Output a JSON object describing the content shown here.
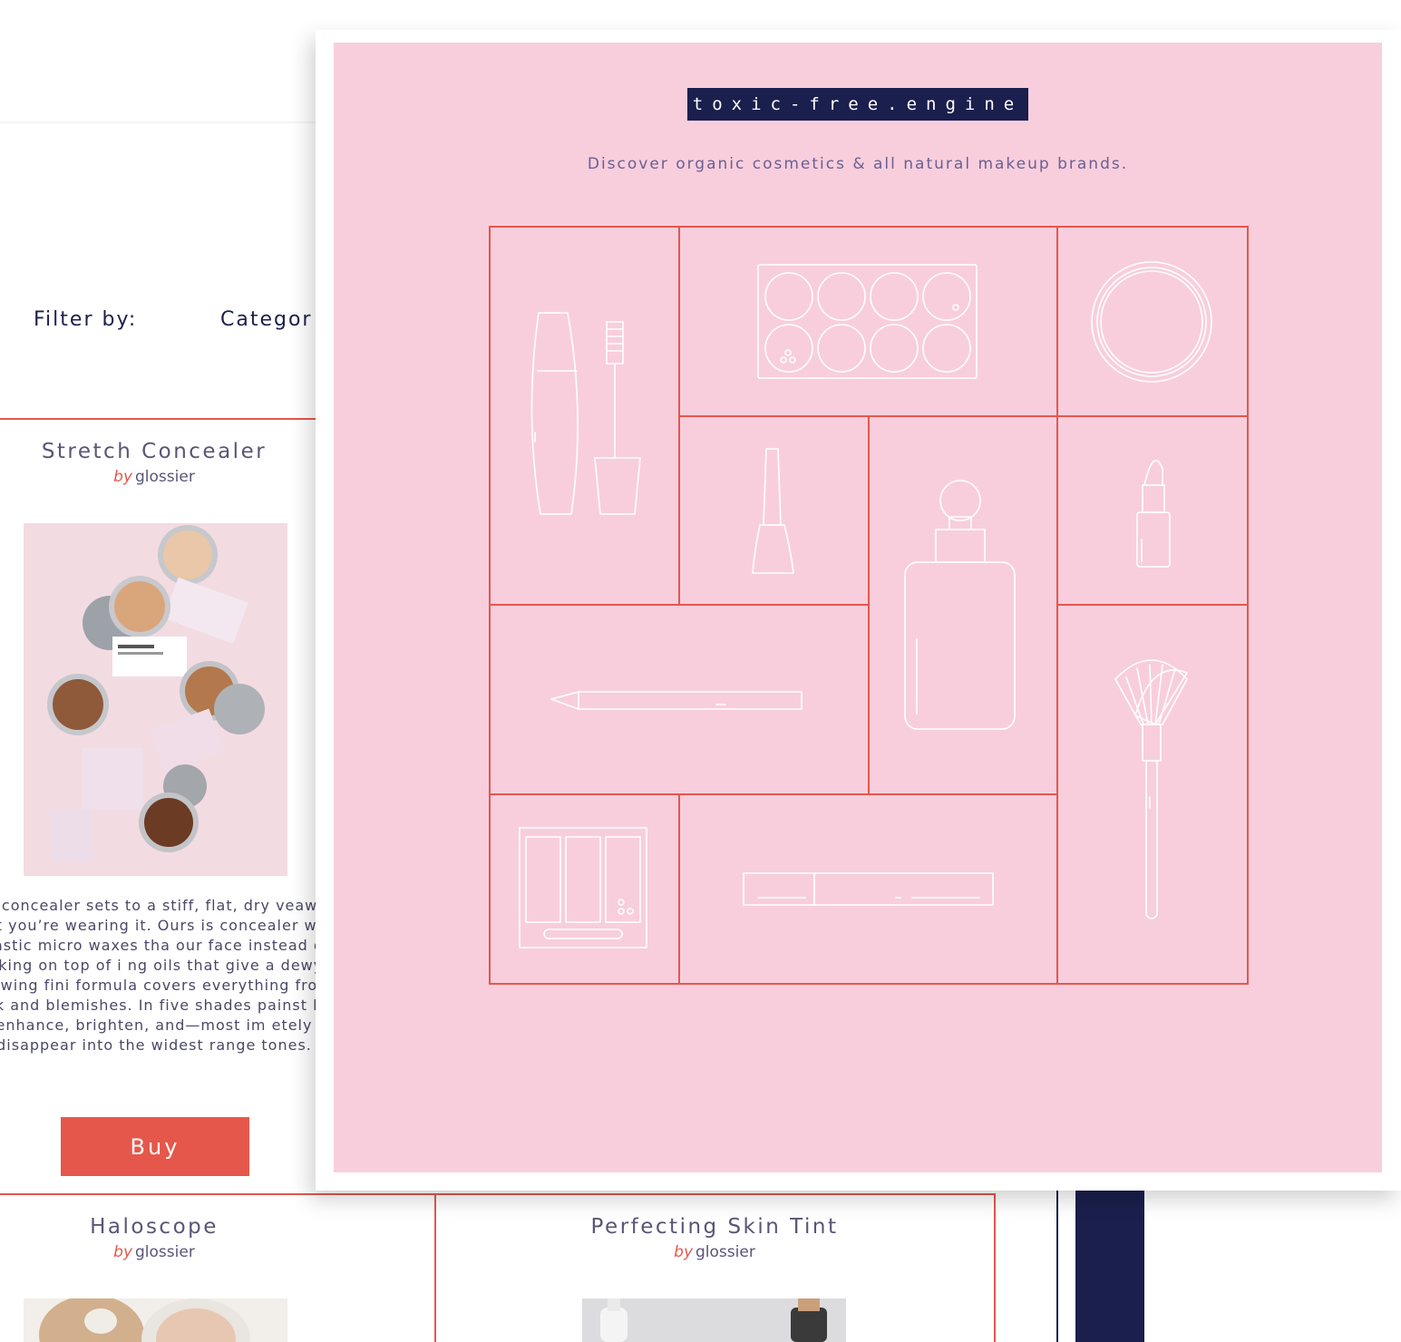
{
  "filter": {
    "label": "Filter by:",
    "category_label": "Categor"
  },
  "products": [
    {
      "title": "Stretch Concealer",
      "by": "by",
      "brand": "glossier",
      "description": "nal concealer sets to a stiff, flat, dry veaway that you’re wearing it. Ours is concealer with elastic micro waxes tha our face instead of caking on top of i ng oils that give a dewy, glowing fini formula covers everything from dark and blemishes. In five shades painst l to enhance, brighten, and—most im etely disappear into the widest range tones.",
      "buy_label": "Buy"
    },
    {
      "title": "Haloscope",
      "by": "by",
      "brand": "glossier"
    },
    {
      "title": "Perfecting Skin Tint",
      "by": "by",
      "brand": "glossier"
    }
  ],
  "modal": {
    "brand": "toxic-free.engine",
    "tagline": "Discover organic cosmetics & all natural makeup brands."
  },
  "icons": [
    "mascara-icon",
    "eyeshadow-palette-icon",
    "compact-powder-icon",
    "nail-polish-icon",
    "foundation-bottle-icon",
    "lipstick-icon",
    "eyeliner-pencil-icon",
    "makeup-brush-icon",
    "eyeshadow-trio-icon",
    "concealer-stick-icon"
  ],
  "colors": {
    "accent": "#e5574b",
    "navy": "#1a1f4d",
    "pink": "#f8cedd",
    "text": "#5a5577"
  }
}
